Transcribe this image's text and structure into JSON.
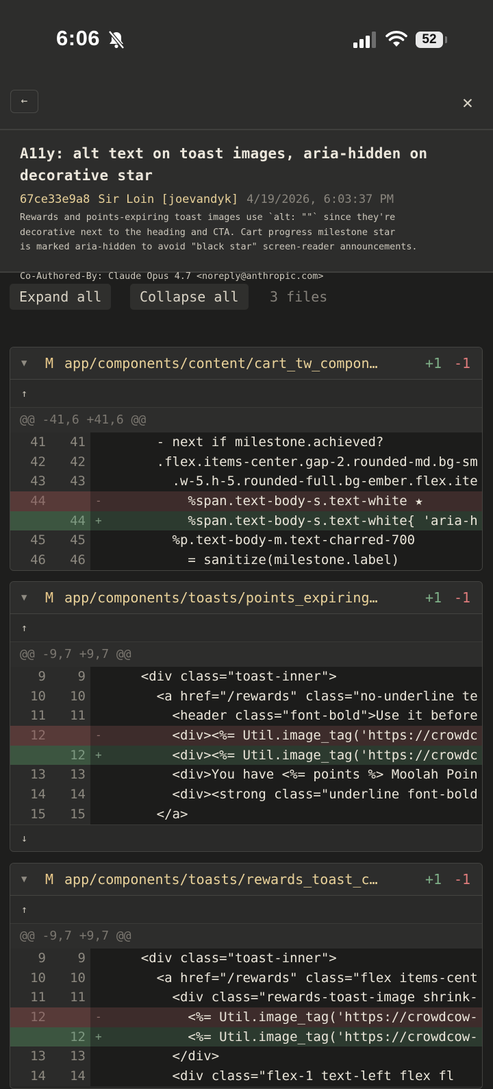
{
  "status_bar": {
    "time": "6:06",
    "battery": "52"
  },
  "commit": {
    "title": "A11y: alt text on toast images, aria-hidden on decorative star",
    "sha": "67ce33e9a8",
    "author": "Sir Loin [joevandyk]",
    "date": "4/19/2026, 6:03:37 PM",
    "body": "Rewards and points-expiring toast images use `alt: \"\"` since they're\ndecorative next to the heading and CTA. Cart progress milestone star\nis marked aria-hidden to avoid \"black star\" screen-reader announcements.\n\nCo-Authored-By: Claude Opus 4.7 <noreply@anthropic.com>"
  },
  "toolbar": {
    "expand_all": "Expand all",
    "collapse_all": "Collapse all",
    "file_count": "3 files"
  },
  "icons": {
    "back": "arrow-left-icon",
    "close": "close-icon",
    "caret": "caret-down-icon",
    "expand_up": "arrow-up-icon",
    "expand_down": "arrow-down-icon"
  },
  "files": [
    {
      "status": "M",
      "path": "app/components/content/cart_tw_compon…",
      "additions": "+1",
      "deletions": "-1",
      "expand_up": "↑",
      "hunk": "@@ -41,6 +41,6 @@",
      "lines": [
        {
          "type": "ctx",
          "old": "41",
          "new": "41",
          "marker": "",
          "code": "      - next if milestone.achieved?"
        },
        {
          "type": "ctx",
          "old": "42",
          "new": "42",
          "marker": "",
          "code": "      .flex.items-center.gap-2.rounded-md.bg-sm"
        },
        {
          "type": "ctx",
          "old": "43",
          "new": "43",
          "marker": "",
          "code": "        .w-5.h-5.rounded-full.bg-ember.flex.ite"
        },
        {
          "type": "del",
          "old": "44",
          "new": "",
          "marker": "-",
          "code": "          %span.text-body-s.text-white ★"
        },
        {
          "type": "add",
          "old": "",
          "new": "44",
          "marker": "+",
          "code": "          %span.text-body-s.text-white{ 'aria-h"
        },
        {
          "type": "ctx",
          "old": "45",
          "new": "45",
          "marker": "",
          "code": "        %p.text-body-m.text-charred-700"
        },
        {
          "type": "ctx",
          "old": "46",
          "new": "46",
          "marker": "",
          "code": "          = sanitize(milestone.label)"
        }
      ]
    },
    {
      "status": "M",
      "path": "app/components/toasts/points_expiring…",
      "additions": "+1",
      "deletions": "-1",
      "expand_up": "↑",
      "expand_down": "↓",
      "hunk": "@@ -9,7 +9,7 @@",
      "lines": [
        {
          "type": "ctx",
          "old": "9",
          "new": "9",
          "marker": "",
          "code": "    <div class=\"toast-inner\">"
        },
        {
          "type": "ctx",
          "old": "10",
          "new": "10",
          "marker": "",
          "code": "      <a href=\"/rewards\" class=\"no-underline te"
        },
        {
          "type": "ctx",
          "old": "11",
          "new": "11",
          "marker": "",
          "code": "        <header class=\"font-bold\">Use it before"
        },
        {
          "type": "del",
          "old": "12",
          "new": "",
          "marker": "-",
          "code": "        <div><%= Util.image_tag('https://crowdc"
        },
        {
          "type": "add",
          "old": "",
          "new": "12",
          "marker": "+",
          "code": "        <div><%= Util.image_tag('https://crowdc"
        },
        {
          "type": "ctx",
          "old": "13",
          "new": "13",
          "marker": "",
          "code": "        <div>You have <%= points %> Moolah Poin"
        },
        {
          "type": "ctx",
          "old": "14",
          "new": "14",
          "marker": "",
          "code": "        <div><strong class=\"underline font-bold"
        },
        {
          "type": "ctx",
          "old": "15",
          "new": "15",
          "marker": "",
          "code": "      </a>"
        }
      ]
    },
    {
      "status": "M",
      "path": "app/components/toasts/rewards_toast_c…",
      "additions": "+1",
      "deletions": "-1",
      "expand_up": "↑",
      "hunk": "@@ -9,7 +9,7 @@",
      "lines": [
        {
          "type": "ctx",
          "old": "9",
          "new": "9",
          "marker": "",
          "code": "    <div class=\"toast-inner\">"
        },
        {
          "type": "ctx",
          "old": "10",
          "new": "10",
          "marker": "",
          "code": "      <a href=\"/rewards\" class=\"flex items-cent"
        },
        {
          "type": "ctx",
          "old": "11",
          "new": "11",
          "marker": "",
          "code": "        <div class=\"rewards-toast-image shrink-"
        },
        {
          "type": "del",
          "old": "12",
          "new": "",
          "marker": "-",
          "code": "          <%= Util.image_tag('https://crowdcow-"
        },
        {
          "type": "add",
          "old": "",
          "new": "12",
          "marker": "+",
          "code": "          <%= Util.image_tag('https://crowdcow-"
        },
        {
          "type": "ctx",
          "old": "13",
          "new": "13",
          "marker": "",
          "code": "        </div>"
        },
        {
          "type": "ctx",
          "old": "14",
          "new": "14",
          "marker": "",
          "code": "        <div class=\"flex-1 text-left flex fl"
        }
      ]
    }
  ]
}
